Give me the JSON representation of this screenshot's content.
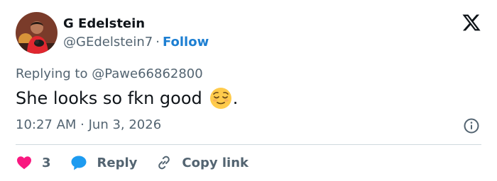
{
  "author": {
    "name": "G Edelstein",
    "handle": "@GEdelstein7",
    "separator": "·",
    "follow_label": "Follow"
  },
  "tweet": {
    "replying_prefix": "Replying to",
    "replying_to": "@Pawe66862800",
    "text": "She looks so fkn good",
    "emoji": "relieved-face",
    "text_suffix": ".",
    "timestamp": "10:27 AM · Jun 3, 2026"
  },
  "actions": {
    "like_count": "3",
    "reply_label": "Reply",
    "copy_link_label": "Copy link"
  },
  "colors": {
    "follow": "#1d7fd2",
    "like": "#f91880",
    "reply_bubble": "#1d9bf0",
    "muted": "#536471"
  },
  "icons": [
    "x-logo-icon",
    "info-icon",
    "heart-icon",
    "reply-bubble-icon",
    "link-icon"
  ]
}
